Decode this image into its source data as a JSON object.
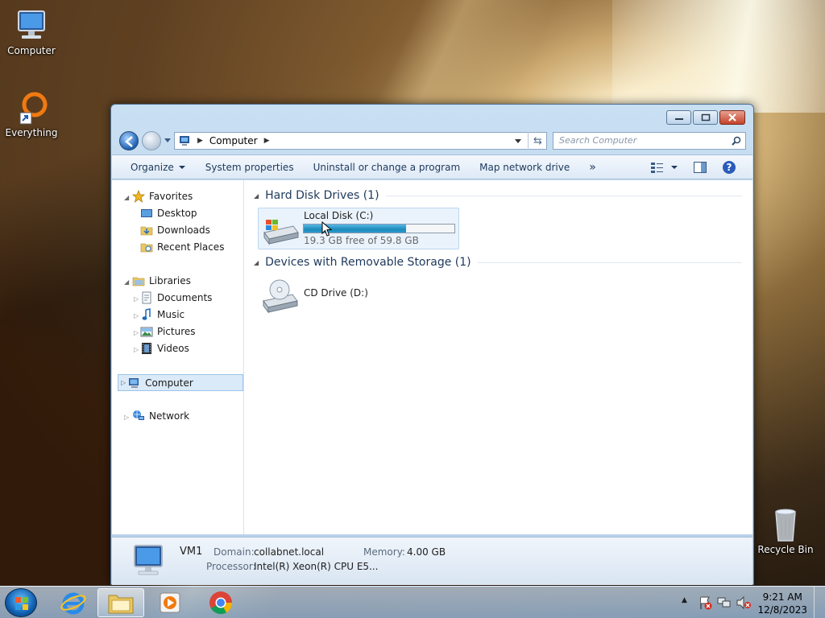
{
  "desktop": {
    "icons": [
      {
        "label": "Computer"
      },
      {
        "label": "Everything"
      },
      {
        "label": "Recycle Bin"
      }
    ]
  },
  "window": {
    "breadcrumb": "Computer",
    "search_placeholder": "Search Computer",
    "toolbar": {
      "organize": "Organize",
      "system_properties": "System properties",
      "uninstall": "Uninstall or change a program",
      "map_drive": "Map network drive",
      "more": "»"
    },
    "nav": {
      "favorites": "Favorites",
      "desktop": "Desktop",
      "downloads": "Downloads",
      "recent": "Recent Places",
      "libraries": "Libraries",
      "documents": "Documents",
      "music": "Music",
      "pictures": "Pictures",
      "videos": "Videos",
      "computer": "Computer",
      "network": "Network"
    },
    "groups": {
      "hdd": "Hard Disk Drives (1)",
      "removable": "Devices with Removable Storage (1)"
    },
    "drives": {
      "c_name": "Local Disk (C:)",
      "c_free": "19.3 GB free of 59.8 GB",
      "c_used_fraction": 0.68,
      "d_name": "CD Drive (D:)"
    },
    "details": {
      "name": "VM1",
      "domain_label": "Domain:",
      "domain_value": "collabnet.local",
      "memory_label": "Memory:",
      "memory_value": "4.00 GB",
      "processor_label": "Processor:",
      "processor_value": "Intel(R) Xeon(R) CPU E5..."
    }
  },
  "taskbar": {
    "time": "9:21 AM",
    "date": "12/8/2023"
  },
  "colors": {
    "accent": "#1e395b",
    "progress": "#26a0da"
  }
}
